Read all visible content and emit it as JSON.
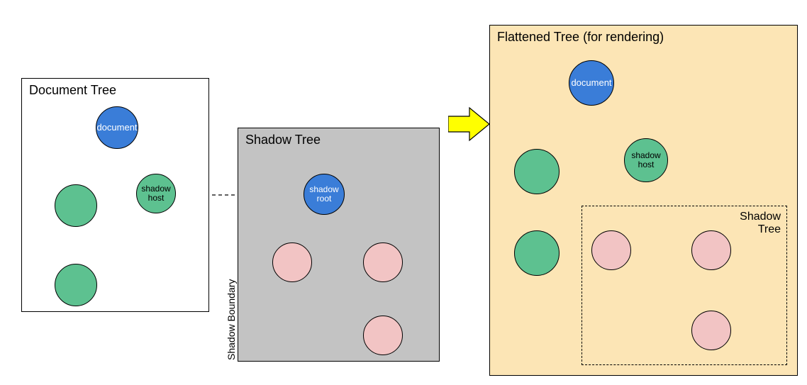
{
  "documentTree": {
    "title": "Document Tree",
    "nodes": {
      "document": "document",
      "shadowHost": "shadow\nhost"
    }
  },
  "shadowTree": {
    "title": "Shadow Tree",
    "boundaryLabel": "Shadow Boundary",
    "nodes": {
      "shadowRoot": "shadow\nroot"
    }
  },
  "flattenedTree": {
    "title": "Flattened Tree (for rendering)",
    "innerLabel": "Shadow\nTree",
    "nodes": {
      "document": "document",
      "shadowHost": "shadow\nhost"
    }
  }
}
